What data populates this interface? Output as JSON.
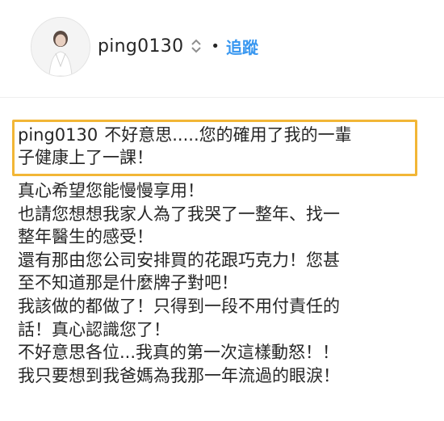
{
  "header": {
    "username": "ping0130",
    "dot": "•",
    "follow_label": "追蹤"
  },
  "comment": {
    "username": "ping0130",
    "highlighted_lines": [
      "不好意思.....您的確用了我的一輩",
      "子健康上了一課！"
    ],
    "lines": [
      "真心希望您能慢慢享用！",
      "也請您想想我家人為了我哭了一整年、找一",
      "整年醫生的感受！",
      "還有那由您公司安排買的花跟巧克力！您甚",
      "至不知道那是什麼牌子對吧！",
      "我該做的都做了！只得到一段不用付責任的",
      "話！真心認識您了！",
      "不好意思各位...我真的第一次這樣動怒！！",
      "我只要想到我爸媽為我那一年流過的眼淚！"
    ]
  },
  "colors": {
    "highlight_border": "#f2b636",
    "follow": "#3897f0",
    "text": "#262626"
  },
  "icons": {
    "avatar": "profile-avatar",
    "sort": "updown-chevron-icon"
  }
}
